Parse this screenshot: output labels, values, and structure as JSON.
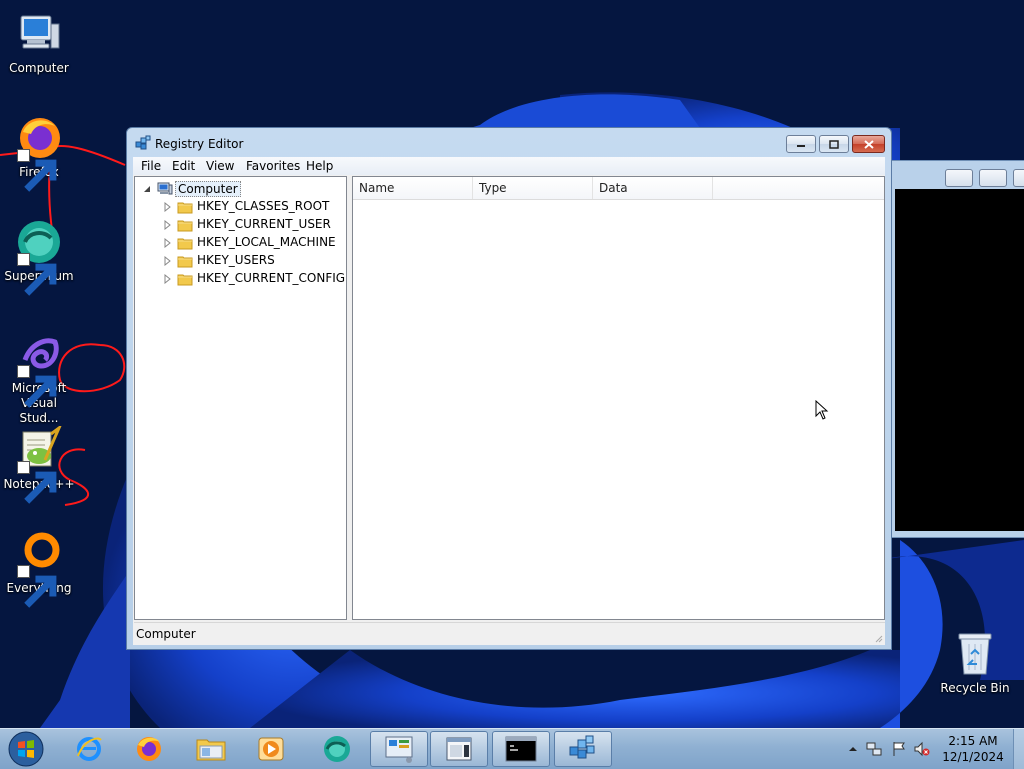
{
  "desktop": {
    "icons": [
      {
        "label": "Computer",
        "icon": "computer-icon"
      },
      {
        "label": "Firefox",
        "icon": "firefox-icon"
      },
      {
        "label": "Supermium",
        "icon": "supermium-icon"
      },
      {
        "label": "Microsoft Visual Stud...",
        "icon": "visual-studio-icon"
      },
      {
        "label": "Notepad++",
        "icon": "notepadpp-icon"
      },
      {
        "label": "Everything",
        "icon": "everything-icon"
      },
      {
        "label": "Recycle Bin",
        "icon": "recycle-bin-icon"
      }
    ]
  },
  "window": {
    "title": "Registry Editor",
    "menu": [
      "File",
      "Edit",
      "View",
      "Favorites",
      "Help"
    ],
    "tree": {
      "root": "Computer",
      "children": [
        "HKEY_CLASSES_ROOT",
        "HKEY_CURRENT_USER",
        "HKEY_LOCAL_MACHINE",
        "HKEY_USERS",
        "HKEY_CURRENT_CONFIG"
      ]
    },
    "columns": [
      "Name",
      "Type",
      "Data"
    ],
    "status": "Computer"
  },
  "taskbar": {
    "pinned": [
      "internet-explorer-icon",
      "firefox-icon",
      "file-explorer-icon",
      "media-player-icon",
      "supermium-icon",
      "control-panel-icon",
      "window-icon",
      "command-prompt-icon",
      "registry-editor-icon"
    ],
    "tray": [
      "chevron-up-icon",
      "network-icon",
      "flag-icon",
      "volume-muted-icon"
    ],
    "time": "2:15 AM",
    "date": "12/1/2024"
  },
  "colors": {
    "desktop_bg": "#05183f",
    "wallpaper_blue": "#1a4bd6",
    "taskbar": "#8fb0d2",
    "window_frame": "#b9d1ea"
  }
}
